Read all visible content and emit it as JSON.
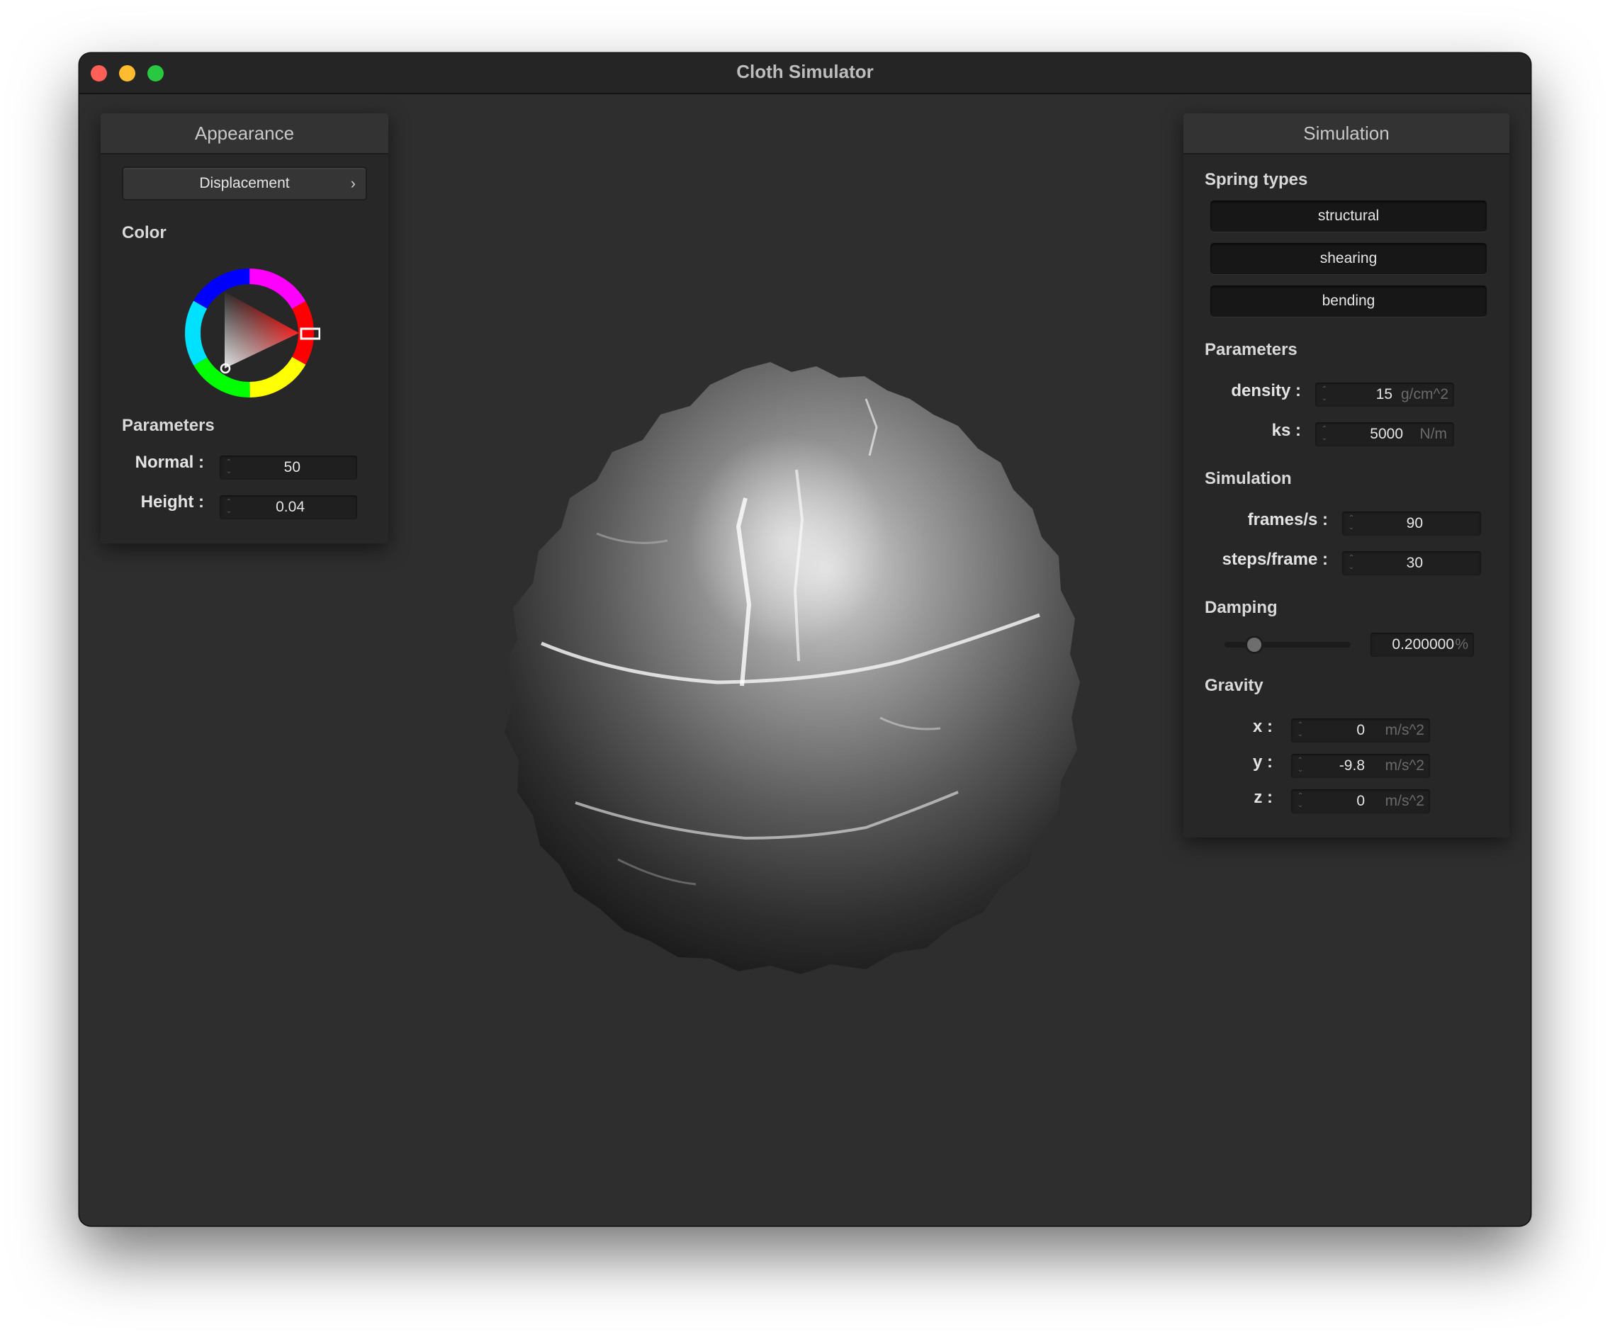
{
  "window": {
    "title": "Cloth Simulator"
  },
  "appearance": {
    "header": "Appearance",
    "shader_popup": {
      "label": "Displacement",
      "chevron": "›"
    },
    "color_label": "Color",
    "color_wheel": {
      "hue_color": "#ff1e1e",
      "icon": "color-wheel"
    },
    "params_label": "Parameters",
    "normal": {
      "label": "Normal :",
      "value": "50"
    },
    "height": {
      "label": "Height :",
      "value": "0.04"
    }
  },
  "simulation": {
    "header": "Simulation",
    "spring_types_label": "Spring types",
    "spring_types": [
      "structural",
      "shearing",
      "bending"
    ],
    "parameters_label": "Parameters",
    "density": {
      "label": "density :",
      "value": "15",
      "unit": "g/cm^2"
    },
    "ks": {
      "label": "ks :",
      "value": "5000",
      "unit": "N/m"
    },
    "sim_label": "Simulation",
    "fps": {
      "label": "frames/s :",
      "value": "90"
    },
    "steps": {
      "label": "steps/frame :",
      "value": "30"
    },
    "damping_label": "Damping",
    "damping": {
      "value": "0.200000",
      "unit": "%",
      "slider_level": 0.2
    },
    "gravity_label": "Gravity",
    "gravity_x": {
      "label": "x :",
      "value": "0",
      "unit": "m/s^2"
    },
    "gravity_y": {
      "label": "y :",
      "value": "-9.8",
      "unit": "m/s^2"
    },
    "gravity_z": {
      "label": "z :",
      "value": "0",
      "unit": "m/s^2"
    }
  },
  "colors": {
    "window_bg": "#2e2e2e",
    "panel_bg": "#272727",
    "traffic_close": "#fe5f57",
    "traffic_minimize": "#febc2e",
    "traffic_maximize": "#28c840"
  }
}
